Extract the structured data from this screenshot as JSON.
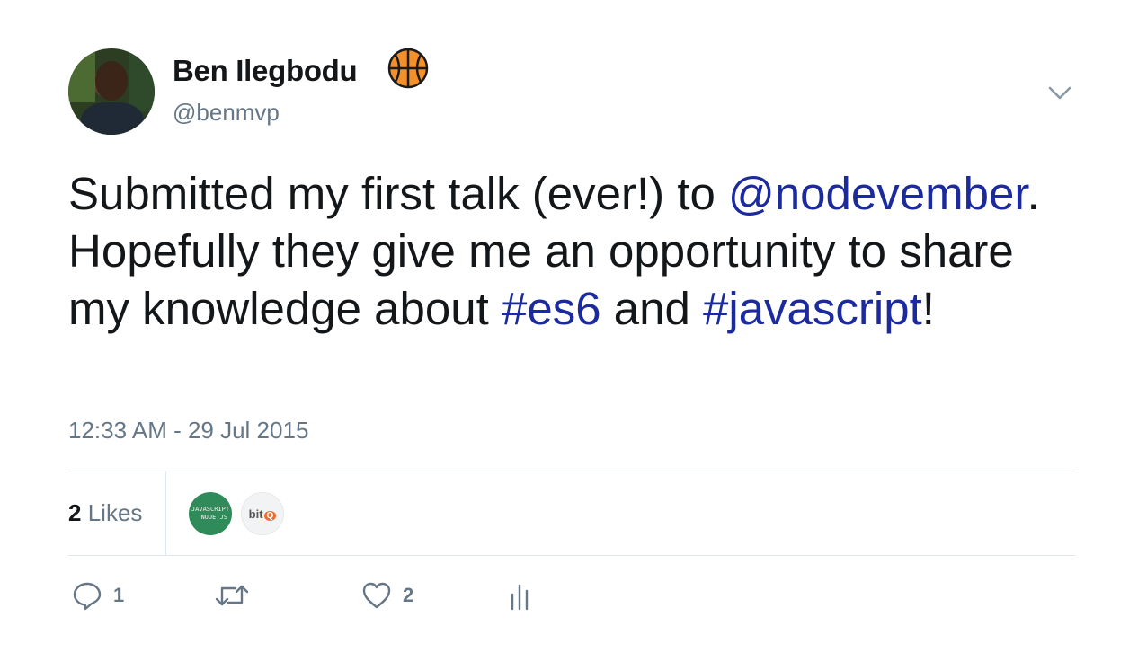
{
  "author": {
    "name": "Ben Ilegbodu",
    "handle": "@benmvp",
    "emoji_icon": "basketball-icon"
  },
  "tweet": {
    "segments": [
      {
        "text": "Submitted my first talk (ever!) to ",
        "link": false
      },
      {
        "text": "@nodevember",
        "link": true
      },
      {
        "text": ". Hopefully they give me an opportunity to share my knowledge about ",
        "link": false
      },
      {
        "text": "#es6",
        "link": true
      },
      {
        "text": " and ",
        "link": false
      },
      {
        "text": "#javascript",
        "link": true
      },
      {
        "text": "!",
        "link": false
      }
    ],
    "timestamp": "12:33 AM - 29 Jul 2015"
  },
  "likes": {
    "count": "2",
    "label": "Likes",
    "likers": [
      {
        "name": "javascript-nodejs",
        "text": "JAVASCRIPT\n  NODE.JS"
      },
      {
        "name": "bitq",
        "text": "bit",
        "badge": "Q"
      }
    ]
  },
  "actions": {
    "reply_count": "1",
    "retweet_count": "",
    "like_count": "2"
  },
  "colors": {
    "link": "#1b2a9c",
    "secondary_text": "#657786",
    "divider": "#e1e8ed"
  }
}
